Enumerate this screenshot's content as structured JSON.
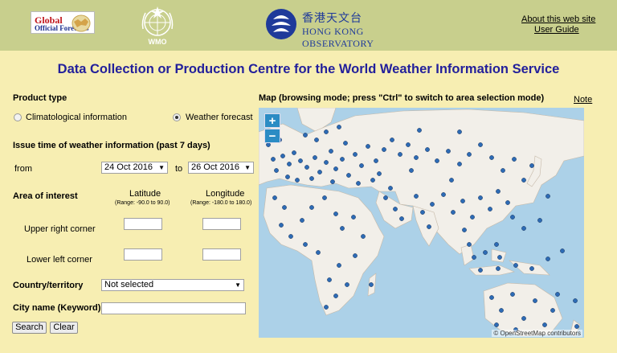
{
  "header": {
    "gof_logo": {
      "line1": "Global",
      "line2": "Official Forecasts"
    },
    "wmo_logo": {
      "text": "WMO"
    },
    "hko_logo": {
      "chinese": "香港天文台",
      "english": "HONG KONG OBSERVATORY"
    },
    "links": [
      "About this web site",
      "User Guide"
    ]
  },
  "page_title": "Data Collection or Production Centre for the World Weather Information Service",
  "product_type": {
    "label": "Product type",
    "options": [
      {
        "label": "Climatological information",
        "selected": false
      },
      {
        "label": "Weather forecast",
        "selected": true
      }
    ]
  },
  "issue_time": {
    "label": "Issue time of weather information (past 7 days)",
    "from_label": "from",
    "from_value": "24 Oct 2016",
    "to_label": "to",
    "to_value": "26 Oct 2016"
  },
  "area": {
    "label": "Area of interest",
    "latitude_label": "Latitude",
    "latitude_range": "(Range: -90.0 to 90.0)",
    "longitude_label": "Longitude",
    "longitude_range": "(Range: -180.0 to 180.0)",
    "upper_right_label": "Upper right corner",
    "lower_left_label": "Lower left corner"
  },
  "country": {
    "label": "Country/territory",
    "value": "Not selected"
  },
  "city": {
    "label": "City name (Keyword)",
    "value": ""
  },
  "buttons": {
    "search": "Search",
    "clear": "Clear"
  },
  "map": {
    "label": "Map (browsing mode; press \"Ctrl\" to switch to area selection mode)",
    "note_link": "Note",
    "zoom_in": "+",
    "zoom_out": "−",
    "attribution": "© OpenStreetMap contributors",
    "colors": {
      "sea": "#acd1e8",
      "land": "#f2efe9",
      "marker": "#2d6bb5"
    }
  }
}
